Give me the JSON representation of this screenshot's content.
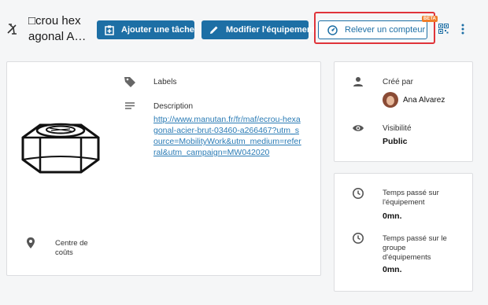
{
  "header": {
    "title_line1": "□crou hex",
    "title_line2": "agonal A…",
    "add_task_label": "Ajouter une tâche",
    "edit_equipment_label": "Modifier l'équipement",
    "read_counter_label": "Relever un compteur",
    "beta_badge": "BETA",
    "icons": [
      "equipment-icon",
      "add-task-icon",
      "pencil-icon",
      "gauge-icon",
      "qr-code-icon",
      "more-vert-icon"
    ]
  },
  "details": {
    "labels_title": "Labels",
    "description_title": "Description",
    "description_link": "http://www.manutan.fr/fr/maf/ecrou-hexagonal-acier-brut-03460-a266467?utm_source=MobilityWork&utm_medium=referral&utm_campaign=MW042020",
    "cost_center_label": "Centre de coûts"
  },
  "creator": {
    "created_by_label": "Créé par",
    "created_by_name": "Ana Alvarez",
    "visibility_label": "Visibilité",
    "visibility_value": "Public"
  },
  "time": {
    "equipment_time_label": "Temps passé sur l'équipement",
    "equipment_time_value": "0mn.",
    "group_time_label": "Temps passé sur le groupe d'équipements",
    "group_time_value": "0mn."
  },
  "colors": {
    "primary": "#1d6fa5",
    "highlight": "#e0343a",
    "beta": "#f07e2a",
    "link": "#2a7bb5"
  }
}
